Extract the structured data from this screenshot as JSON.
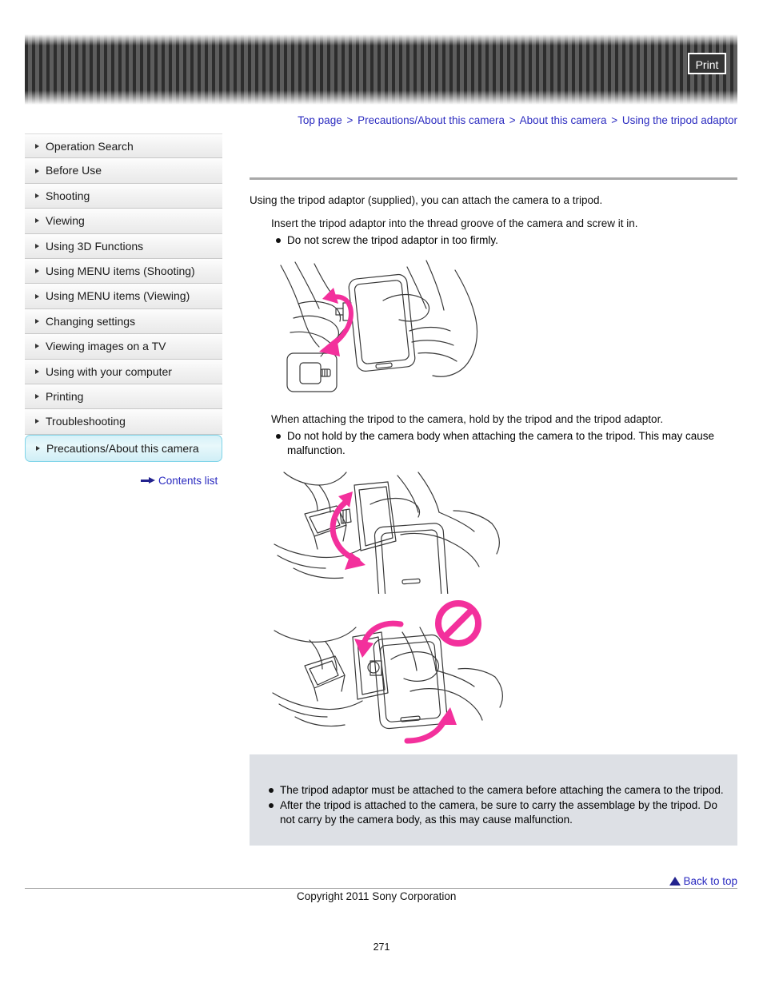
{
  "header": {
    "print_label": "Print"
  },
  "breadcrumb": {
    "separator": ">",
    "items": [
      {
        "label": "Top page"
      },
      {
        "label": "Precautions/About this camera"
      },
      {
        "label": "About this camera"
      },
      {
        "label": "Using the tripod adaptor"
      }
    ]
  },
  "sidebar": {
    "items": [
      {
        "label": "Operation Search",
        "selected": false
      },
      {
        "label": "Before Use",
        "selected": false
      },
      {
        "label": "Shooting",
        "selected": false
      },
      {
        "label": "Viewing",
        "selected": false
      },
      {
        "label": "Using 3D Functions",
        "selected": false
      },
      {
        "label": "Using MENU items (Shooting)",
        "selected": false
      },
      {
        "label": "Using MENU items (Viewing)",
        "selected": false
      },
      {
        "label": "Changing settings",
        "selected": false
      },
      {
        "label": "Viewing images on a TV",
        "selected": false
      },
      {
        "label": "Using with your computer",
        "selected": false
      },
      {
        "label": "Printing",
        "selected": false
      },
      {
        "label": "Troubleshooting",
        "selected": false
      },
      {
        "label": "Precautions/About this camera",
        "selected": true
      }
    ],
    "contents_list_label": "Contents list"
  },
  "main": {
    "intro": "Using the tripod adaptor (supplied), you can attach the camera to a tripod.",
    "step1": "Insert the tripod adaptor into the thread groove of the camera and screw it in.",
    "step1_bullets": [
      "Do not screw the tripod adaptor in too firmly."
    ],
    "step2": "When attaching the tripod to the camera, hold by the tripod and the tripod adaptor.",
    "step2_bullets": [
      "Do not hold by the camera body when attaching the camera to the tripod. This may cause malfunction."
    ],
    "figure1_alt": "Illustration: hands screwing the tripod adaptor into the thread groove of the camera, with a pink rotation arrow and an inset close-up of the tripod adaptor",
    "figure2_alt": "Illustration: hands holding the tripod and the tripod adaptor while attaching the camera, with a pink rotation arrow",
    "figure3_alt": "Illustration: prohibited example of holding the camera body while attaching to the tripod, marked with a pink no-entry symbol",
    "note_bullets": [
      "The tripod adaptor must be attached to the camera before attaching the camera to the tripod.",
      "After the tripod is attached to the camera, be sure to carry the assemblage by the tripod. Do not carry by the camera body, as this may cause malfunction."
    ]
  },
  "footer": {
    "back_to_top_label": "Back to top",
    "copyright": "Copyright 2011 Sony Corporation",
    "page_number": "271"
  },
  "colors": {
    "link": "#2b2bc0",
    "arrow_accent": "#23238e",
    "note_box_bg": "#dde0e5",
    "selected_nav_border": "#7fd4e8",
    "illustration_accent": "#f3309c"
  }
}
